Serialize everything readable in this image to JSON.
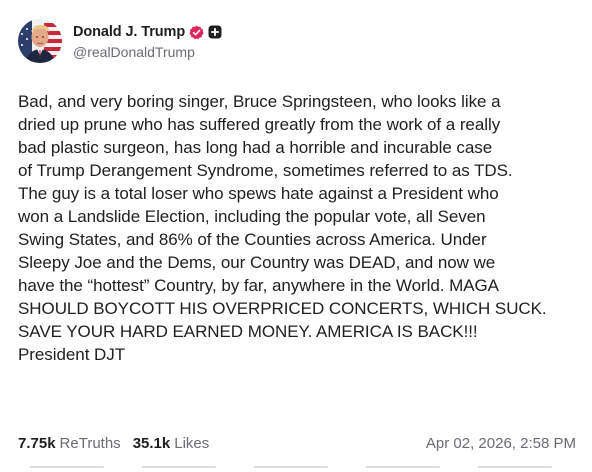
{
  "author": {
    "display_name": "Donald J. Trump",
    "handle": "@realDonaldTrump",
    "avatar_icon": "portrait-avatar",
    "verified_icon": "verified-badge-icon",
    "verified_color": "#e0245e",
    "subscribe_icon": "plus-square-icon"
  },
  "post": {
    "text": "Bad, and very boring singer, Bruce Springsteen, who looks like a\ndried up prune who has suffered greatly from the work of a really\nbad plastic surgeon, has long had a horrible and incurable case\nof Trump Derangement Syndrome, sometimes referred to as TDS.\nThe guy is a total loser who spews hate against a President who\nwon a Landslide Election, including the popular vote, all Seven\nSwing States, and 86% of the Counties across America. Under\nSleepy Joe and the Dems, our Country was DEAD, and now we\nhave the “hottest” Country, by far, anywhere in the World. MAGA\nSHOULD BOYCOTT HIS OVERPRICED CONCERTS, WHICH SUCK.\nSAVE YOUR HARD EARNED MONEY. AMERICA IS BACK!!!\nPresident DJT"
  },
  "stats": {
    "retruths_count": "7.75k",
    "retruths_label": "ReTruths",
    "likes_count": "35.1k",
    "likes_label": "Likes"
  },
  "timestamp": "Apr 02, 2026, 2:58 PM"
}
